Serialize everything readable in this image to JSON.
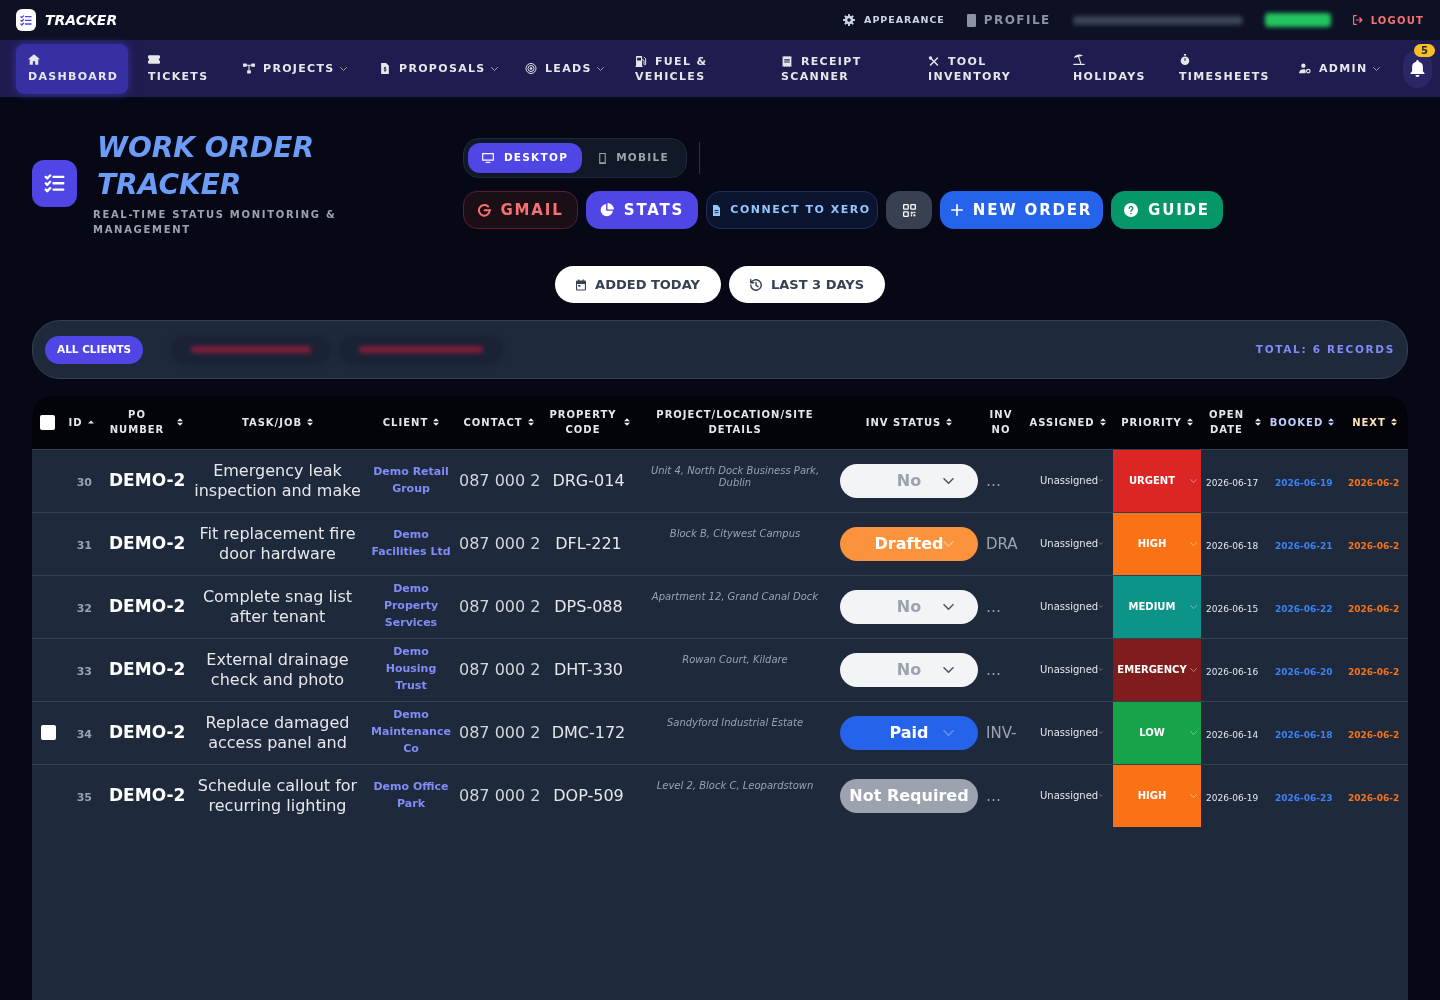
{
  "top_bar": {
    "brand": "TRACKER",
    "appearance_link": {
      "label": "APPEARANCE"
    },
    "profile_link": {
      "label": "PROFILE"
    },
    "logout_link": {
      "label": "LOGOUT"
    }
  },
  "nav": {
    "items": [
      {
        "label": "DASHBOARD",
        "selected": true,
        "dropdown": false
      },
      {
        "label": "TICKETS",
        "selected": false,
        "dropdown": false
      },
      {
        "label": "PROJECTS",
        "selected": false,
        "dropdown": true
      },
      {
        "label": "PROPOSALS",
        "selected": false,
        "dropdown": true
      },
      {
        "label": "LEADS",
        "selected": false,
        "dropdown": true
      },
      {
        "label": "FUEL & VEHICLES",
        "selected": false,
        "dropdown": false
      },
      {
        "label": "RECEIPT SCANNER",
        "selected": false,
        "dropdown": false
      },
      {
        "label": "TOOL INVENTORY",
        "selected": false,
        "dropdown": false
      },
      {
        "label": "HOLIDAYS",
        "selected": false,
        "dropdown": false
      },
      {
        "label": "TIMESHEETS",
        "selected": false,
        "dropdown": false
      },
      {
        "label": "ADMIN",
        "selected": false,
        "dropdown": true
      }
    ],
    "notifications": {
      "badge": "5"
    }
  },
  "header": {
    "title": "WORK ORDER TRACKER",
    "subtitle": "REAL-TIME STATUS MONITORING & MANAGEMENT",
    "view_toggle": [
      {
        "kind": "desktop",
        "label": "DESKTOP",
        "selected": true
      },
      {
        "kind": "mobile",
        "label": "MOBILE",
        "selected": false
      }
    ],
    "actions": [
      {
        "kind": "gmail",
        "label": "GMAIL"
      },
      {
        "kind": "stats",
        "label": "STATS"
      },
      {
        "kind": "xero",
        "label": "CONNECT TO XERO"
      },
      {
        "kind": "qr"
      },
      {
        "kind": "new",
        "label": "NEW ORDER"
      },
      {
        "kind": "guide",
        "label": "GUIDE"
      }
    ],
    "quick_filters": [
      {
        "kind": "today",
        "label": "ADDED TODAY"
      },
      {
        "kind": "recent",
        "label": "LAST 3 DAYS"
      }
    ]
  },
  "client_filter": {
    "chips": [
      {
        "label": "ALL CLIENTS",
        "selected": true
      }
    ],
    "total": "TOTAL: 6 RECORDS"
  },
  "table": {
    "select_all": {
      "checked": false
    },
    "columns": [
      {
        "label": "ID",
        "sortable": true,
        "sorted": true
      },
      {
        "label": "PO NUMBER",
        "sortable": true,
        "sorted": false
      },
      {
        "label": "TASK/JOB",
        "sortable": true,
        "sorted": false
      },
      {
        "label": "CLIENT",
        "sortable": true,
        "sorted": false
      },
      {
        "label": "CONTACT",
        "sortable": true,
        "sorted": false
      },
      {
        "label": "PROPERTY CODE",
        "sortable": true,
        "sorted": false
      },
      {
        "label": "PROJECT/LOCATION/SITE DETAILS",
        "sortable": false,
        "sorted": false
      },
      {
        "label": "INV STATUS",
        "sortable": true,
        "sorted": false
      },
      {
        "label": "INV NO",
        "sortable": false,
        "sorted": false
      },
      {
        "label": "ASSIGNED",
        "sortable": true,
        "sorted": false
      },
      {
        "label": "PRIORITY",
        "sortable": true,
        "sorted": false
      },
      {
        "label": "OPEN DATE",
        "sortable": true,
        "sorted": false
      },
      {
        "label": "BOOKED",
        "sortable": true,
        "sorted": false,
        "color": "#bfcffd"
      },
      {
        "label": "NEXT",
        "sortable": true,
        "sorted": false,
        "color": "#fde2b8"
      }
    ],
    "rows": [
      {
        "id": "30",
        "po_number": "DEMO-2",
        "task": "Emergency leak inspection and make",
        "client": "Demo Retail Group",
        "contact": "087 000 2",
        "property_code": "DRG-014",
        "location": "Unit 4, North Dock Business Park, Dublin",
        "inv_status": {
          "kind": "no",
          "label": "No"
        },
        "inv_no": "…",
        "assigned": "Unassigned",
        "priority": {
          "label": "URGENT",
          "color": "#dc2626"
        },
        "open_date": "2026-06-17",
        "booked": "2026-06-19",
        "next": "2026-06-2"
      },
      {
        "id": "31",
        "po_number": "DEMO-2",
        "task": "Fit replacement fire door hardware",
        "client": "Demo Facilities Ltd",
        "contact": "087 000 2",
        "property_code": "DFL-221",
        "location": "Block B, Citywest Campus",
        "inv_status": {
          "kind": "drafted",
          "label": "Drafted"
        },
        "inv_no": "DRA",
        "assigned": "Unassigned",
        "priority": {
          "label": "HIGH",
          "color": "#f97316"
        },
        "open_date": "2026-06-18",
        "booked": "2026-06-21",
        "next": "2026-06-2"
      },
      {
        "id": "32",
        "po_number": "DEMO-2",
        "task": "Complete snag list after tenant",
        "client": "Demo Property Services",
        "contact": "087 000 2",
        "property_code": "DPS-088",
        "location": "Apartment 12, Grand Canal Dock",
        "inv_status": {
          "kind": "no",
          "label": "No"
        },
        "inv_no": "…",
        "assigned": "Unassigned",
        "priority": {
          "label": "MEDIUM",
          "color": "#0d9488"
        },
        "open_date": "2026-06-15",
        "booked": "2026-06-22",
        "next": "2026-06-2"
      },
      {
        "id": "33",
        "po_number": "DEMO-2",
        "task": "External drainage check and photo",
        "client": "Demo Housing Trust",
        "contact": "087 000 2",
        "property_code": "DHT-330",
        "location": "Rowan Court, Kildare",
        "inv_status": {
          "kind": "no",
          "label": "No"
        },
        "inv_no": "…",
        "assigned": "Unassigned",
        "priority": {
          "label": "EMERGENCY",
          "color": "#7f1d1d"
        },
        "open_date": "2026-06-16",
        "booked": "2026-06-20",
        "next": "2026-06-2"
      },
      {
        "checkbox": {
          "checked": false
        },
        "id": "34",
        "po_number": "DEMO-2",
        "task": "Replace damaged access panel and",
        "client": "Demo Maintenance Co",
        "contact": "087 000 2",
        "property_code": "DMC-172",
        "location": "Sandyford Industrial Estate",
        "inv_status": {
          "kind": "paid",
          "label": "Paid"
        },
        "inv_no": "INV-",
        "assigned": "Unassigned",
        "priority": {
          "label": "LOW",
          "color": "#16a34a"
        },
        "open_date": "2026-06-14",
        "booked": "2026-06-18",
        "next": "2026-06-2"
      },
      {
        "id": "35",
        "po_number": "DEMO-2",
        "task": "Schedule callout for recurring lighting",
        "client": "Demo Office Park",
        "contact": "087 000 2",
        "property_code": "DOP-509",
        "location": "Level 2, Block C, Leopardstown",
        "inv_status": {
          "kind": "not_required",
          "label": "Not Required"
        },
        "inv_no": "…",
        "assigned": "Unassigned",
        "priority": {
          "label": "HIGH",
          "color": "#f97316"
        },
        "open_date": "2026-06-19",
        "booked": "2026-06-23",
        "next": "2026-06-2"
      }
    ]
  }
}
